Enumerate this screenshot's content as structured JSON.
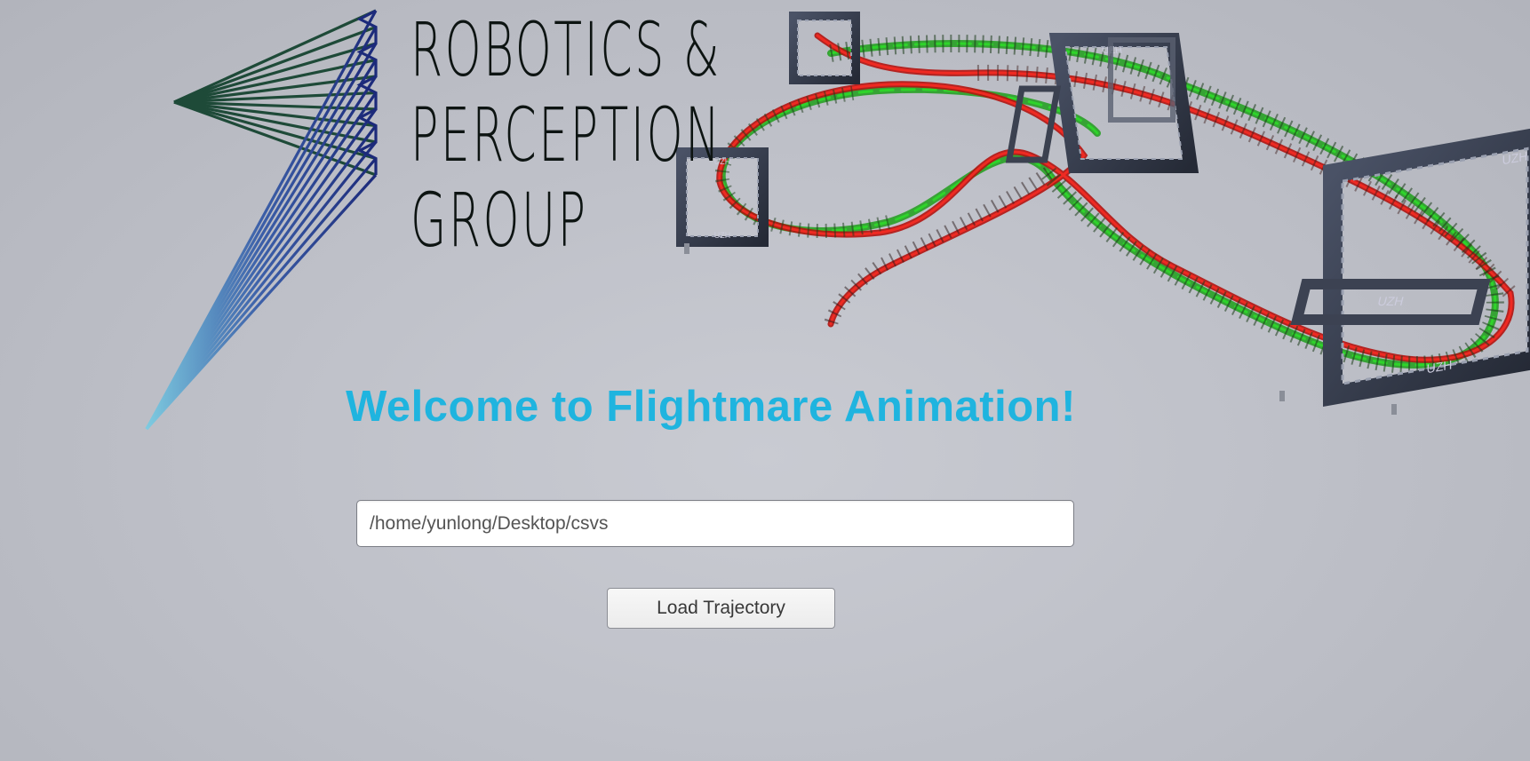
{
  "app": {
    "colors": {
      "background": "#c3c5cc",
      "accent": "#1fb4df",
      "logo_text": "#0d1412",
      "trajectory_green": "#22c41e",
      "trajectory_red": "#e01b16",
      "gate_frame": "#3a4050"
    }
  },
  "logo": {
    "line1": "ROBOTICS &",
    "line2": "PERCEPTION",
    "line3": "GROUP",
    "icon": "rpg-fan-lines-logo"
  },
  "scene": {
    "gate_label": "UZH"
  },
  "main": {
    "welcome_title": "Welcome to Flightmare Animation!",
    "path_input": {
      "value": "/home/yunlong/Desktop/csvs",
      "placeholder": ""
    },
    "load_button_label": "Load Trajectory"
  }
}
